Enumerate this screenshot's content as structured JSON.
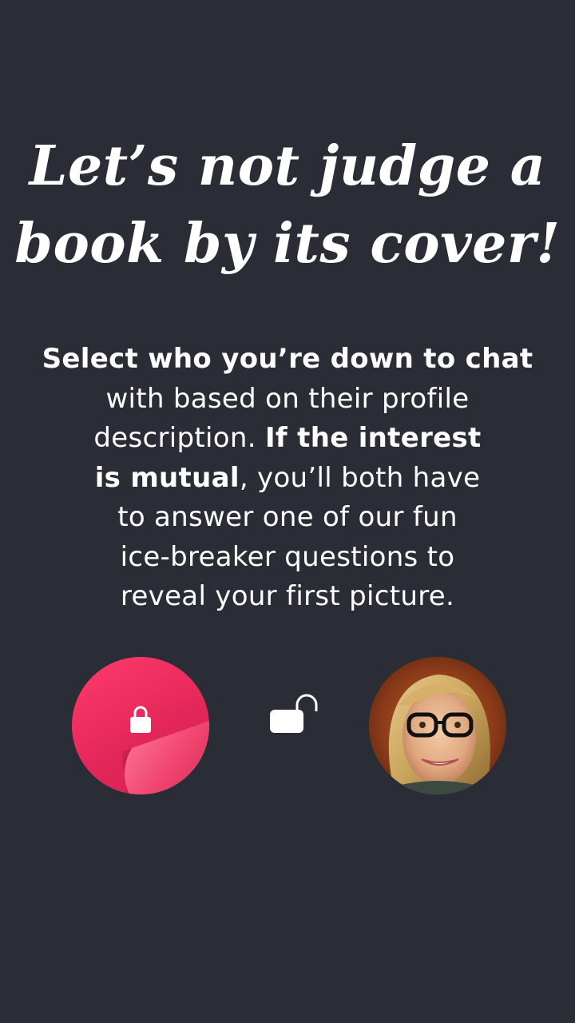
{
  "headline": {
    "line1": "Let’s not judge a",
    "line2": "book by its cover!"
  },
  "description": {
    "line1": "Select who you’re down to chat",
    "line2": "with based on their profile",
    "line3_regular": "description. ",
    "line3_bold": "If the interest",
    "line4_bold": "is mutual",
    "line4_regular": ", you’ll both have",
    "line5": "to answer one of our fun",
    "line6": "ice-breaker questions to",
    "line7": "reveal your first picture."
  },
  "icons": {
    "locked_avatar": "locked-avatar-icon",
    "lock_closed": "lock-closed-icon",
    "lock_open": "lock-open-icon",
    "profile_photo": "profile-photo"
  },
  "colors": {
    "background": "#2a2d36",
    "accent": "#e8285e",
    "text": "#ffffff"
  }
}
